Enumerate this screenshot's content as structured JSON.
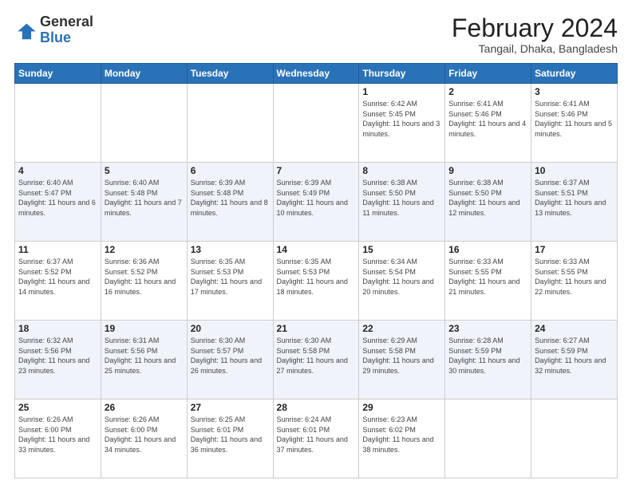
{
  "logo": {
    "general": "General",
    "blue": "Blue"
  },
  "title": "February 2024",
  "subtitle": "Tangail, Dhaka, Bangladesh",
  "days_of_week": [
    "Sunday",
    "Monday",
    "Tuesday",
    "Wednesday",
    "Thursday",
    "Friday",
    "Saturday"
  ],
  "weeks": [
    {
      "row_type": "normal",
      "days": [
        {
          "num": "",
          "info": ""
        },
        {
          "num": "",
          "info": ""
        },
        {
          "num": "",
          "info": ""
        },
        {
          "num": "",
          "info": ""
        },
        {
          "num": "1",
          "info": "Sunrise: 6:42 AM\nSunset: 5:45 PM\nDaylight: 11 hours\nand 3 minutes."
        },
        {
          "num": "2",
          "info": "Sunrise: 6:41 AM\nSunset: 5:46 PM\nDaylight: 11 hours\nand 4 minutes."
        },
        {
          "num": "3",
          "info": "Sunrise: 6:41 AM\nSunset: 5:46 PM\nDaylight: 11 hours\nand 5 minutes."
        }
      ]
    },
    {
      "row_type": "alt",
      "days": [
        {
          "num": "4",
          "info": "Sunrise: 6:40 AM\nSunset: 5:47 PM\nDaylight: 11 hours\nand 6 minutes."
        },
        {
          "num": "5",
          "info": "Sunrise: 6:40 AM\nSunset: 5:48 PM\nDaylight: 11 hours\nand 7 minutes."
        },
        {
          "num": "6",
          "info": "Sunrise: 6:39 AM\nSunset: 5:48 PM\nDaylight: 11 hours\nand 8 minutes."
        },
        {
          "num": "7",
          "info": "Sunrise: 6:39 AM\nSunset: 5:49 PM\nDaylight: 11 hours\nand 10 minutes."
        },
        {
          "num": "8",
          "info": "Sunrise: 6:38 AM\nSunset: 5:50 PM\nDaylight: 11 hours\nand 11 minutes."
        },
        {
          "num": "9",
          "info": "Sunrise: 6:38 AM\nSunset: 5:50 PM\nDaylight: 11 hours\nand 12 minutes."
        },
        {
          "num": "10",
          "info": "Sunrise: 6:37 AM\nSunset: 5:51 PM\nDaylight: 11 hours\nand 13 minutes."
        }
      ]
    },
    {
      "row_type": "normal",
      "days": [
        {
          "num": "11",
          "info": "Sunrise: 6:37 AM\nSunset: 5:52 PM\nDaylight: 11 hours\nand 14 minutes."
        },
        {
          "num": "12",
          "info": "Sunrise: 6:36 AM\nSunset: 5:52 PM\nDaylight: 11 hours\nand 16 minutes."
        },
        {
          "num": "13",
          "info": "Sunrise: 6:35 AM\nSunset: 5:53 PM\nDaylight: 11 hours\nand 17 minutes."
        },
        {
          "num": "14",
          "info": "Sunrise: 6:35 AM\nSunset: 5:53 PM\nDaylight: 11 hours\nand 18 minutes."
        },
        {
          "num": "15",
          "info": "Sunrise: 6:34 AM\nSunset: 5:54 PM\nDaylight: 11 hours\nand 20 minutes."
        },
        {
          "num": "16",
          "info": "Sunrise: 6:33 AM\nSunset: 5:55 PM\nDaylight: 11 hours\nand 21 minutes."
        },
        {
          "num": "17",
          "info": "Sunrise: 6:33 AM\nSunset: 5:55 PM\nDaylight: 11 hours\nand 22 minutes."
        }
      ]
    },
    {
      "row_type": "alt",
      "days": [
        {
          "num": "18",
          "info": "Sunrise: 6:32 AM\nSunset: 5:56 PM\nDaylight: 11 hours\nand 23 minutes."
        },
        {
          "num": "19",
          "info": "Sunrise: 6:31 AM\nSunset: 5:56 PM\nDaylight: 11 hours\nand 25 minutes."
        },
        {
          "num": "20",
          "info": "Sunrise: 6:30 AM\nSunset: 5:57 PM\nDaylight: 11 hours\nand 26 minutes."
        },
        {
          "num": "21",
          "info": "Sunrise: 6:30 AM\nSunset: 5:58 PM\nDaylight: 11 hours\nand 27 minutes."
        },
        {
          "num": "22",
          "info": "Sunrise: 6:29 AM\nSunset: 5:58 PM\nDaylight: 11 hours\nand 29 minutes."
        },
        {
          "num": "23",
          "info": "Sunrise: 6:28 AM\nSunset: 5:59 PM\nDaylight: 11 hours\nand 30 minutes."
        },
        {
          "num": "24",
          "info": "Sunrise: 6:27 AM\nSunset: 5:59 PM\nDaylight: 11 hours\nand 32 minutes."
        }
      ]
    },
    {
      "row_type": "normal",
      "days": [
        {
          "num": "25",
          "info": "Sunrise: 6:26 AM\nSunset: 6:00 PM\nDaylight: 11 hours\nand 33 minutes."
        },
        {
          "num": "26",
          "info": "Sunrise: 6:26 AM\nSunset: 6:00 PM\nDaylight: 11 hours\nand 34 minutes."
        },
        {
          "num": "27",
          "info": "Sunrise: 6:25 AM\nSunset: 6:01 PM\nDaylight: 11 hours\nand 36 minutes."
        },
        {
          "num": "28",
          "info": "Sunrise: 6:24 AM\nSunset: 6:01 PM\nDaylight: 11 hours\nand 37 minutes."
        },
        {
          "num": "29",
          "info": "Sunrise: 6:23 AM\nSunset: 6:02 PM\nDaylight: 11 hours\nand 38 minutes."
        },
        {
          "num": "",
          "info": ""
        },
        {
          "num": "",
          "info": ""
        }
      ]
    }
  ]
}
